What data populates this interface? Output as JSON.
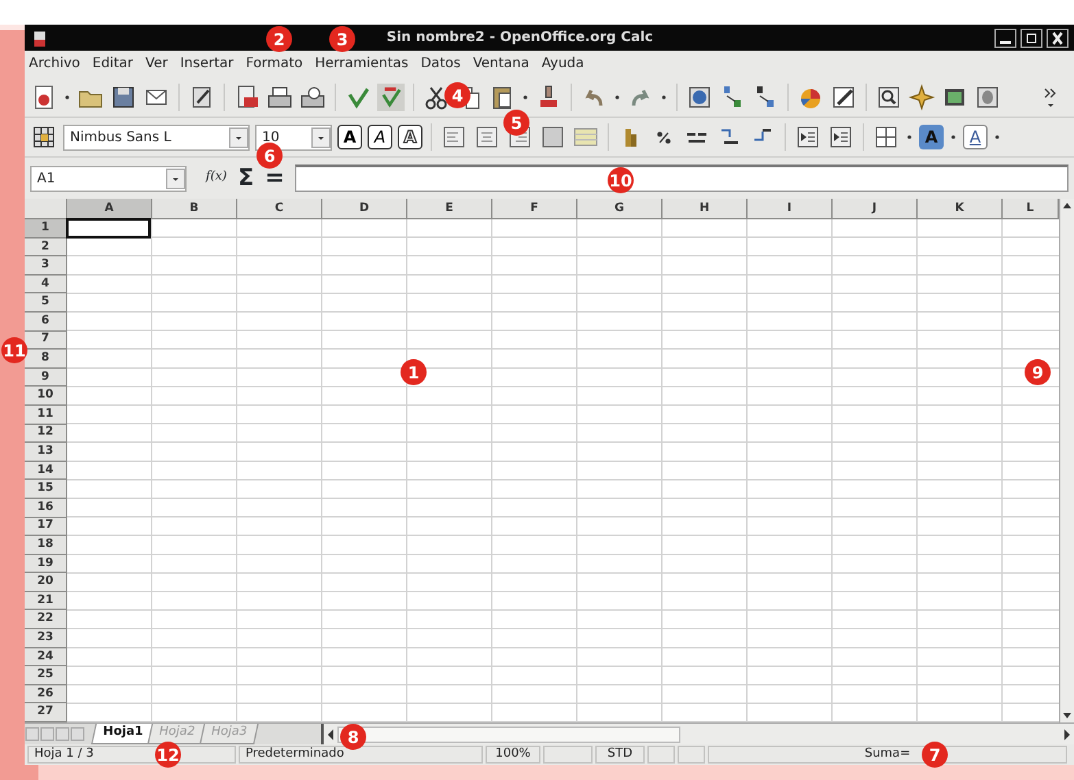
{
  "window": {
    "title": "Sin nombre2 - OpenOffice.org Calc"
  },
  "menu": [
    "Archivo",
    "Editar",
    "Ver",
    "Insertar",
    "Formato",
    "Herramientas",
    "Datos",
    "Ventana",
    "Ayuda"
  ],
  "toolbar": {
    "auto_spellcheck_on": true
  },
  "formatting": {
    "font_name": "Nimbus Sans L",
    "font_size": "10",
    "format_buttons": [
      {
        "kind": "bold",
        "label": "A"
      },
      {
        "kind": "italic",
        "label": "A"
      },
      {
        "kind": "outline",
        "label": "A"
      }
    ],
    "color_buttons": [
      {
        "kind": "highlight",
        "label": "A"
      },
      {
        "kind": "font_color",
        "label": "A"
      }
    ]
  },
  "formula_bar": {
    "name_box": "A1",
    "function_wizard": "f(x)",
    "sum": "Σ",
    "equals": "="
  },
  "columns": [
    {
      "label": "A",
      "selected": true
    },
    {
      "label": "B",
      "selected": false
    },
    {
      "label": "C",
      "selected": false
    },
    {
      "label": "D",
      "selected": false
    },
    {
      "label": "E",
      "selected": false
    },
    {
      "label": "F",
      "selected": false
    },
    {
      "label": "G",
      "selected": false
    },
    {
      "label": "H",
      "selected": false
    },
    {
      "label": "I",
      "selected": false
    },
    {
      "label": "J",
      "selected": false
    },
    {
      "label": "K",
      "selected": false
    },
    {
      "label": "L",
      "selected": false
    }
  ],
  "rows": [
    {
      "label": "1",
      "selected": true
    },
    {
      "label": "2",
      "selected": false
    },
    {
      "label": "3",
      "selected": false
    },
    {
      "label": "4",
      "selected": false
    },
    {
      "label": "5",
      "selected": false
    },
    {
      "label": "6",
      "selected": false
    },
    {
      "label": "7",
      "selected": false
    },
    {
      "label": "8",
      "selected": false
    },
    {
      "label": "9",
      "selected": false
    },
    {
      "label": "10",
      "selected": false
    },
    {
      "label": "11",
      "selected": false
    },
    {
      "label": "12",
      "selected": false
    },
    {
      "label": "13",
      "selected": false
    },
    {
      "label": "14",
      "selected": false
    },
    {
      "label": "15",
      "selected": false
    },
    {
      "label": "16",
      "selected": false
    },
    {
      "label": "17",
      "selected": false
    },
    {
      "label": "18",
      "selected": false
    },
    {
      "label": "19",
      "selected": false
    },
    {
      "label": "20",
      "selected": false
    },
    {
      "label": "21",
      "selected": false
    },
    {
      "label": "22",
      "selected": false
    },
    {
      "label": "23",
      "selected": false
    },
    {
      "label": "24",
      "selected": false
    },
    {
      "label": "25",
      "selected": false
    },
    {
      "label": "26",
      "selected": false
    },
    {
      "label": "27",
      "selected": false
    }
  ],
  "sheet_tabs": [
    {
      "label": "Hoja1",
      "selected": true
    },
    {
      "label": "Hoja2",
      "selected": false
    },
    {
      "label": "Hoja3",
      "selected": false
    }
  ],
  "status_bar": {
    "sheet": "Hoja 1 / 3",
    "page_style": "Predeterminado",
    "zoom": "100%",
    "selection_mode": "STD",
    "sum": "Suma="
  },
  "callouts": [
    {
      "label": "1"
    },
    {
      "label": "2"
    },
    {
      "label": "3"
    },
    {
      "label": "4"
    },
    {
      "label": "5"
    },
    {
      "label": "6"
    },
    {
      "label": "7"
    },
    {
      "label": "8"
    },
    {
      "label": "9"
    },
    {
      "label": "10"
    },
    {
      "label": "11"
    },
    {
      "label": "12"
    }
  ]
}
